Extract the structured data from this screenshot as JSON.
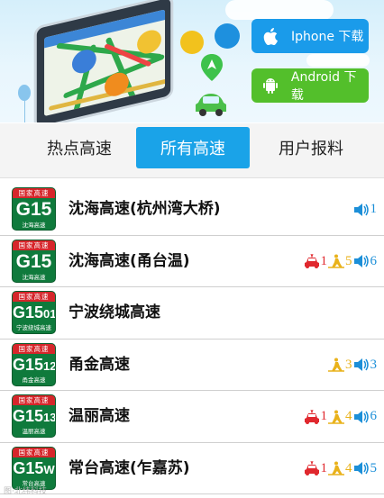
{
  "banner": {
    "iphone_label": "Iphone 下载",
    "android_label": "Android 下载"
  },
  "tabs": [
    {
      "label": "热点高速",
      "active": false
    },
    {
      "label": "所有高速",
      "active": true
    },
    {
      "label": "用户报料",
      "active": false
    }
  ],
  "sign_header": "国家高速",
  "highways": [
    {
      "code": "G15",
      "code_sub": "",
      "sign_name": "沈海高速",
      "name": "沈海高速(杭州湾大桥)",
      "accidents": null,
      "construction": null,
      "reports": "1"
    },
    {
      "code": "G15",
      "code_sub": "",
      "sign_name": "沈海高速",
      "name": "沈海高速(甬台温)",
      "accidents": "1",
      "construction": "5",
      "reports": "6"
    },
    {
      "code": "G15",
      "code_sub": "01",
      "sign_name": "宁波绕城高速",
      "name": "宁波绕城高速",
      "accidents": null,
      "construction": null,
      "reports": null
    },
    {
      "code": "G15",
      "code_sub": "12",
      "sign_name": "甬金高速",
      "name": "甬金高速",
      "accidents": null,
      "construction": "3",
      "reports": "3"
    },
    {
      "code": "G15",
      "code_sub": "13",
      "sign_name": "温丽高速",
      "name": "温丽高速",
      "accidents": "1",
      "construction": "4",
      "reports": "6"
    },
    {
      "code": "G15",
      "code_sub": "W",
      "sign_name": "常台高速",
      "name": "常台高速(乍嘉苏)",
      "accidents": "1",
      "construction": "4",
      "reports": "5"
    }
  ],
  "colors": {
    "accent": "#1aa3e8",
    "android": "#53bf2b",
    "sign_green": "#0f7a3c",
    "sign_red": "#d6262b",
    "accident": "#e0282e",
    "construction": "#e9b21b",
    "report": "#1c8fd8"
  }
}
